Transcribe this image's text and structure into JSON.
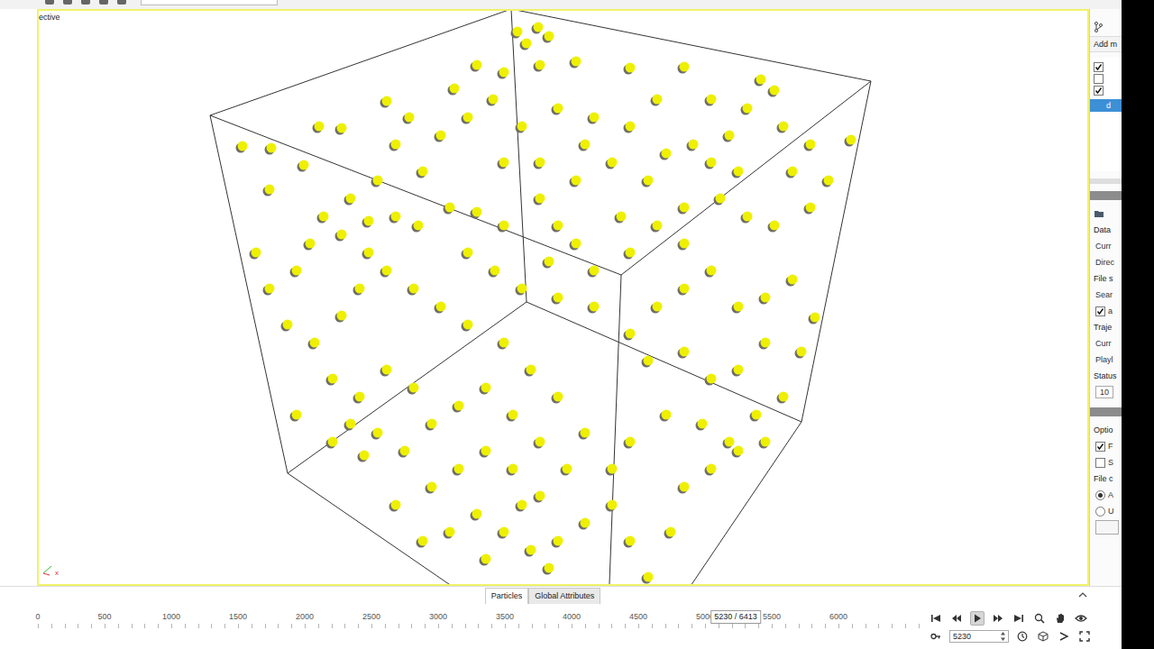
{
  "viewport": {
    "caption": "ective",
    "axis_label": "x",
    "particles": [
      [
        575,
        35
      ],
      [
        598,
        30
      ],
      [
        585,
        48
      ],
      [
        610,
        40
      ],
      [
        530,
        72
      ],
      [
        560,
        80
      ],
      [
        505,
        98
      ],
      [
        548,
        110
      ],
      [
        520,
        130
      ],
      [
        600,
        72
      ],
      [
        640,
        68
      ],
      [
        700,
        75
      ],
      [
        760,
        74
      ],
      [
        845,
        88
      ],
      [
        860,
        100
      ],
      [
        830,
        120
      ],
      [
        870,
        140
      ],
      [
        900,
        160
      ],
      [
        945,
        155
      ],
      [
        880,
        190
      ],
      [
        920,
        200
      ],
      [
        270,
        162
      ],
      [
        302,
        164
      ],
      [
        338,
        183
      ],
      [
        355,
        140
      ],
      [
        380,
        142
      ],
      [
        430,
        112
      ],
      [
        455,
        130
      ],
      [
        490,
        150
      ],
      [
        470,
        190
      ],
      [
        420,
        200
      ],
      [
        390,
        220
      ],
      [
        360,
        240
      ],
      [
        300,
        210
      ],
      [
        285,
        280
      ],
      [
        300,
        320
      ],
      [
        330,
        300
      ],
      [
        345,
        270
      ],
      [
        380,
        260
      ],
      [
        410,
        245
      ],
      [
        440,
        240
      ],
      [
        465,
        250
      ],
      [
        500,
        230
      ],
      [
        530,
        235
      ],
      [
        560,
        250
      ],
      [
        600,
        220
      ],
      [
        620,
        250
      ],
      [
        640,
        270
      ],
      [
        610,
        290
      ],
      [
        660,
        300
      ],
      [
        700,
        280
      ],
      [
        730,
        250
      ],
      [
        760,
        230
      ],
      [
        800,
        220
      ],
      [
        830,
        240
      ],
      [
        860,
        250
      ],
      [
        900,
        230
      ],
      [
        880,
        310
      ],
      [
        850,
        330
      ],
      [
        820,
        340
      ],
      [
        790,
        300
      ],
      [
        760,
        320
      ],
      [
        730,
        340
      ],
      [
        700,
        370
      ],
      [
        720,
        400
      ],
      [
        760,
        390
      ],
      [
        790,
        420
      ],
      [
        820,
        410
      ],
      [
        850,
        380
      ],
      [
        890,
        390
      ],
      [
        905,
        352
      ],
      [
        870,
        440
      ],
      [
        840,
        460
      ],
      [
        810,
        490
      ],
      [
        780,
        470
      ],
      [
        740,
        460
      ],
      [
        700,
        490
      ],
      [
        680,
        520
      ],
      [
        650,
        480
      ],
      [
        620,
        440
      ],
      [
        590,
        410
      ],
      [
        560,
        380
      ],
      [
        520,
        360
      ],
      [
        490,
        340
      ],
      [
        460,
        320
      ],
      [
        430,
        300
      ],
      [
        400,
        320
      ],
      [
        380,
        350
      ],
      [
        350,
        380
      ],
      [
        370,
        420
      ],
      [
        400,
        440
      ],
      [
        430,
        410
      ],
      [
        460,
        430
      ],
      [
        480,
        470
      ],
      [
        510,
        450
      ],
      [
        540,
        430
      ],
      [
        570,
        460
      ],
      [
        600,
        490
      ],
      [
        630,
        520
      ],
      [
        600,
        550
      ],
      [
        570,
        520
      ],
      [
        540,
        500
      ],
      [
        510,
        520
      ],
      [
        480,
        540
      ],
      [
        450,
        500
      ],
      [
        420,
        480
      ],
      [
        390,
        470
      ],
      [
        440,
        560
      ],
      [
        470,
        600
      ],
      [
        500,
        590
      ],
      [
        530,
        570
      ],
      [
        560,
        590
      ],
      [
        590,
        610
      ],
      [
        620,
        600
      ],
      [
        650,
        580
      ],
      [
        680,
        560
      ],
      [
        700,
        600
      ],
      [
        720,
        640
      ],
      [
        610,
        630
      ],
      [
        540,
        620
      ],
      [
        580,
        560
      ],
      [
        520,
        280
      ],
      [
        550,
        300
      ],
      [
        580,
        320
      ],
      [
        620,
        330
      ],
      [
        660,
        340
      ],
      [
        690,
        240
      ],
      [
        720,
        200
      ],
      [
        740,
        170
      ],
      [
        770,
        160
      ],
      [
        790,
        180
      ],
      [
        810,
        150
      ],
      [
        700,
        140
      ],
      [
        660,
        130
      ],
      [
        620,
        120
      ],
      [
        580,
        140
      ],
      [
        560,
        180
      ],
      [
        600,
        180
      ],
      [
        640,
        200
      ],
      [
        680,
        180
      ],
      [
        650,
        160
      ],
      [
        730,
        110
      ],
      [
        790,
        110
      ],
      [
        820,
        190
      ],
      [
        760,
        270
      ],
      [
        440,
        160
      ],
      [
        410,
        280
      ],
      [
        320,
        360
      ],
      [
        330,
        460
      ],
      [
        370,
        490
      ],
      [
        405,
        505
      ],
      [
        760,
        540
      ],
      [
        790,
        520
      ],
      [
        820,
        500
      ],
      [
        850,
        490
      ],
      [
        745,
        590
      ]
    ]
  },
  "side_panel": {
    "add_button": "Add m",
    "pipeline": [
      {
        "checked": true
      },
      {
        "checked": false
      },
      {
        "checked": true
      }
    ],
    "selected_item": {
      "label": "d",
      "selected": true
    },
    "rows": [
      {
        "kind": "bar"
      },
      {
        "kind": "folder"
      },
      {
        "kind": "heading",
        "text": "Data"
      },
      {
        "kind": "label",
        "text": "Curr"
      },
      {
        "kind": "label",
        "text": "Direc"
      },
      {
        "kind": "heading",
        "text": "File s"
      },
      {
        "kind": "label",
        "text": "Sear"
      },
      {
        "kind": "checkbox",
        "text": "a",
        "checked": true
      },
      {
        "kind": "heading",
        "text": "Traje"
      },
      {
        "kind": "label",
        "text": "Curr"
      },
      {
        "kind": "label",
        "text": "Playl"
      },
      {
        "kind": "heading",
        "text": "Status"
      },
      {
        "kind": "field",
        "text": "10"
      },
      {
        "kind": "bar"
      },
      {
        "kind": "heading",
        "text": "Optio"
      },
      {
        "kind": "checkbox",
        "text": "F",
        "checked": true
      },
      {
        "kind": "checkbox",
        "text": "S",
        "checked": false
      },
      {
        "kind": "heading",
        "text": "File c"
      },
      {
        "kind": "radio",
        "text": "A",
        "selected": true
      },
      {
        "kind": "radio",
        "text": "U",
        "selected": false
      },
      {
        "kind": "button"
      }
    ]
  },
  "bottom_tabs": [
    {
      "label": "Particles",
      "selected": true
    },
    {
      "label": "Global Attributes",
      "selected": false
    }
  ],
  "timeline": {
    "ticks": [
      "0",
      "500",
      "1000",
      "1500",
      "2000",
      "2500",
      "3000",
      "3500",
      "4000",
      "4500",
      "5000",
      "5500",
      "6000"
    ],
    "current": "5230",
    "tooltip": "5230 / 6413"
  },
  "playback": [
    {
      "kind": "first",
      "selected": false
    },
    {
      "kind": "back",
      "selected": false
    },
    {
      "kind": "play",
      "selected": true
    },
    {
      "kind": "forward",
      "selected": false
    },
    {
      "kind": "last",
      "selected": false
    }
  ],
  "frame_field": "5230"
}
